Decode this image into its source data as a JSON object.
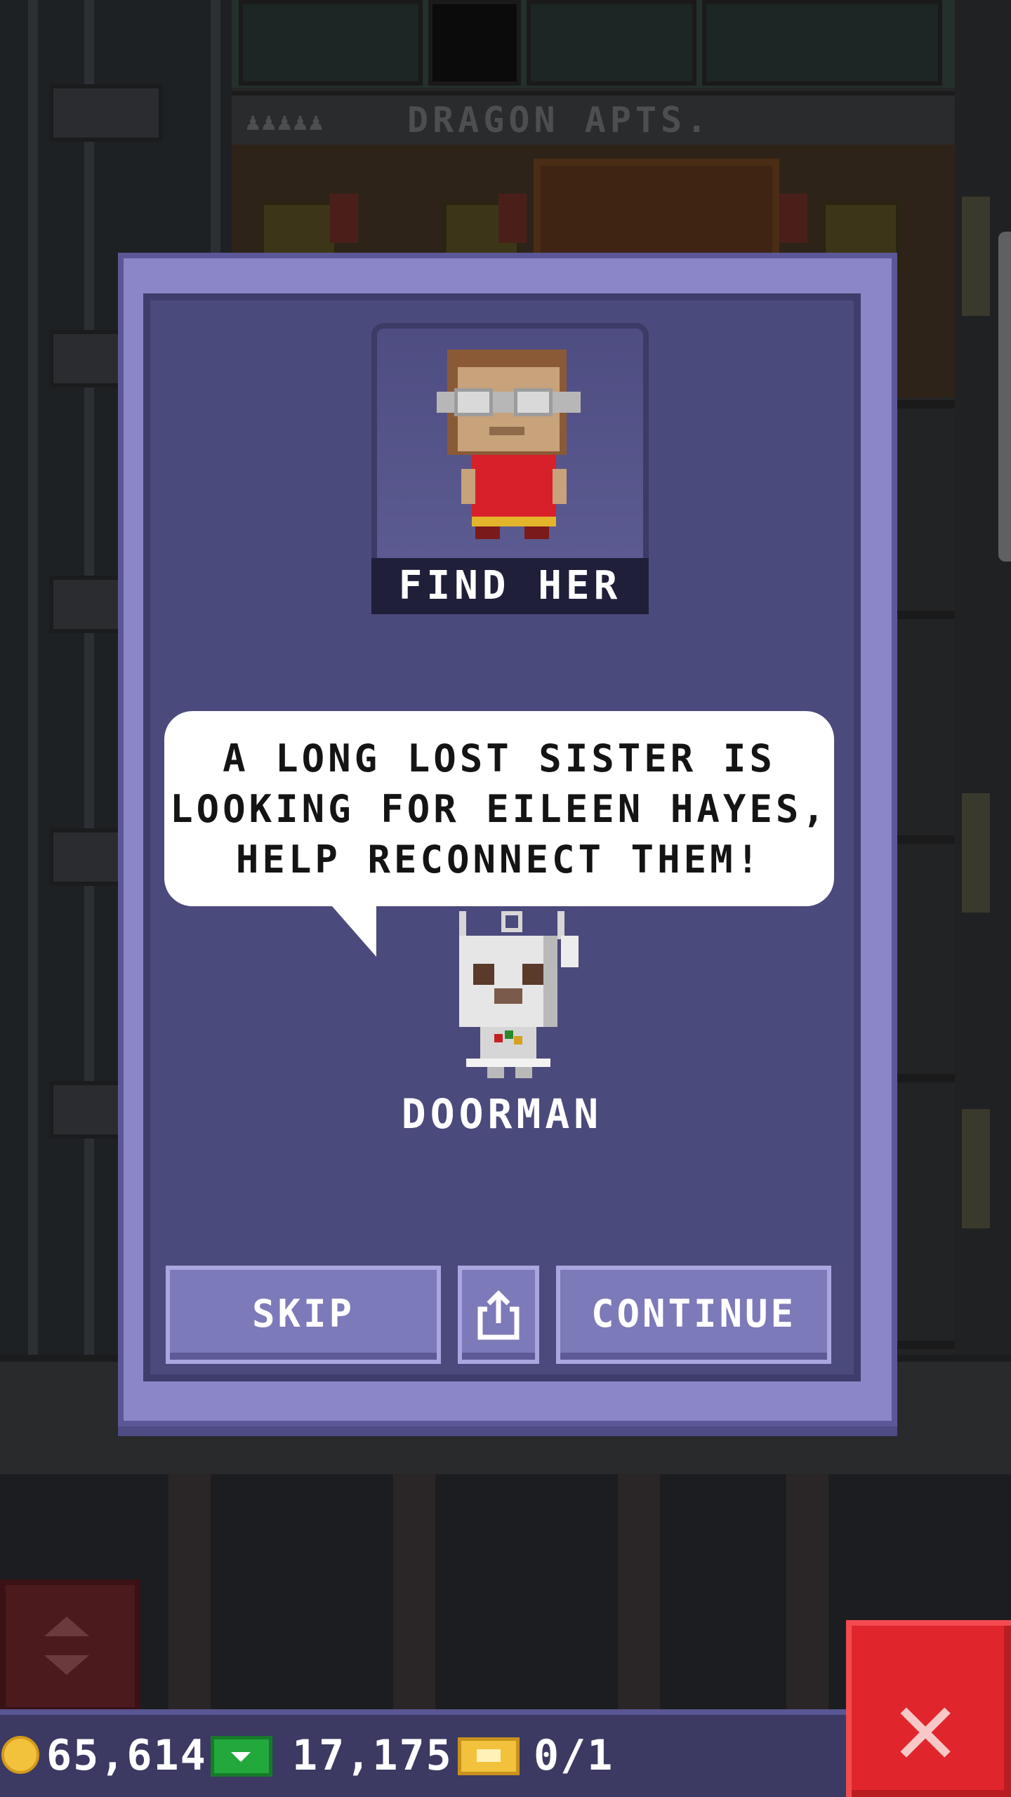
{
  "building": {
    "floor_sign": "DRAGON APTS."
  },
  "dialog": {
    "portrait_caption": "FIND HER",
    "message": "A LONG LOST SISTER IS LOOKING FOR EILEEN HAYES, HELP RECONNECT THEM!",
    "speaker": "DOORMAN",
    "buttons": {
      "skip": "SKIP",
      "continue": "CONTINUE"
    },
    "icons": {
      "share": "share-icon"
    }
  },
  "status_bar": {
    "coins": "65,614",
    "bux": "17,175",
    "tickets": "0/1",
    "icons": {
      "coins": "coin-icon",
      "bux": "bux-icon",
      "tickets": "golden-ticket-icon"
    }
  },
  "controls": {
    "close": "close-icon",
    "elevator": "elevator-arrows-icon"
  },
  "colors": {
    "dialog_border": "#8a86c7",
    "dialog_bg": "#4b4a7c",
    "close_button": "#e0262c",
    "status_bar": "#3c3a63"
  }
}
